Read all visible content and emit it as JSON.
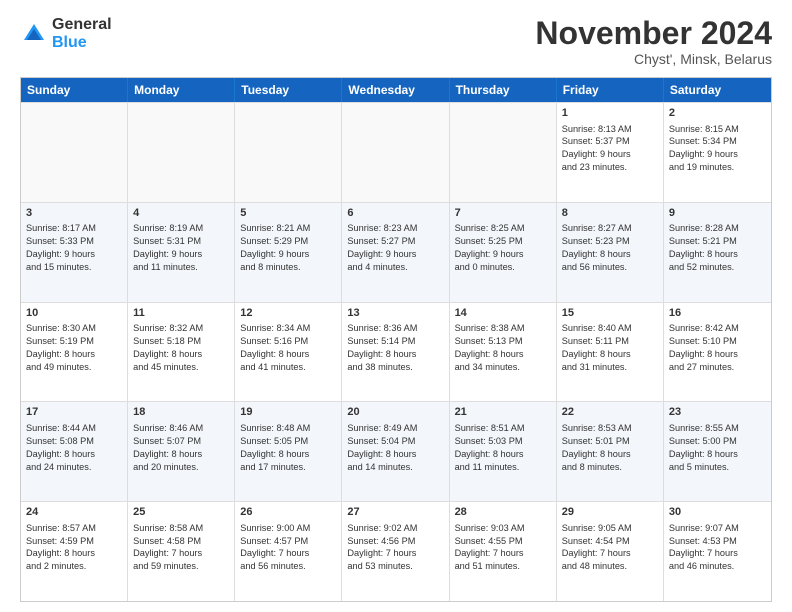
{
  "logo": {
    "general": "General",
    "blue": "Blue"
  },
  "title": "November 2024",
  "location": "Chyst', Minsk, Belarus",
  "headers": [
    "Sunday",
    "Monday",
    "Tuesday",
    "Wednesday",
    "Thursday",
    "Friday",
    "Saturday"
  ],
  "rows": [
    [
      {
        "day": "",
        "lines": [],
        "empty": true
      },
      {
        "day": "",
        "lines": [],
        "empty": true
      },
      {
        "day": "",
        "lines": [],
        "empty": true
      },
      {
        "day": "",
        "lines": [],
        "empty": true
      },
      {
        "day": "",
        "lines": [],
        "empty": true
      },
      {
        "day": "1",
        "lines": [
          "Sunrise: 8:13 AM",
          "Sunset: 5:37 PM",
          "Daylight: 9 hours",
          "and 23 minutes."
        ]
      },
      {
        "day": "2",
        "lines": [
          "Sunrise: 8:15 AM",
          "Sunset: 5:34 PM",
          "Daylight: 9 hours",
          "and 19 minutes."
        ]
      }
    ],
    [
      {
        "day": "3",
        "lines": [
          "Sunrise: 8:17 AM",
          "Sunset: 5:33 PM",
          "Daylight: 9 hours",
          "and 15 minutes."
        ]
      },
      {
        "day": "4",
        "lines": [
          "Sunrise: 8:19 AM",
          "Sunset: 5:31 PM",
          "Daylight: 9 hours",
          "and 11 minutes."
        ]
      },
      {
        "day": "5",
        "lines": [
          "Sunrise: 8:21 AM",
          "Sunset: 5:29 PM",
          "Daylight: 9 hours",
          "and 8 minutes."
        ]
      },
      {
        "day": "6",
        "lines": [
          "Sunrise: 8:23 AM",
          "Sunset: 5:27 PM",
          "Daylight: 9 hours",
          "and 4 minutes."
        ]
      },
      {
        "day": "7",
        "lines": [
          "Sunrise: 8:25 AM",
          "Sunset: 5:25 PM",
          "Daylight: 9 hours",
          "and 0 minutes."
        ]
      },
      {
        "day": "8",
        "lines": [
          "Sunrise: 8:27 AM",
          "Sunset: 5:23 PM",
          "Daylight: 8 hours",
          "and 56 minutes."
        ]
      },
      {
        "day": "9",
        "lines": [
          "Sunrise: 8:28 AM",
          "Sunset: 5:21 PM",
          "Daylight: 8 hours",
          "and 52 minutes."
        ]
      }
    ],
    [
      {
        "day": "10",
        "lines": [
          "Sunrise: 8:30 AM",
          "Sunset: 5:19 PM",
          "Daylight: 8 hours",
          "and 49 minutes."
        ]
      },
      {
        "day": "11",
        "lines": [
          "Sunrise: 8:32 AM",
          "Sunset: 5:18 PM",
          "Daylight: 8 hours",
          "and 45 minutes."
        ]
      },
      {
        "day": "12",
        "lines": [
          "Sunrise: 8:34 AM",
          "Sunset: 5:16 PM",
          "Daylight: 8 hours",
          "and 41 minutes."
        ]
      },
      {
        "day": "13",
        "lines": [
          "Sunrise: 8:36 AM",
          "Sunset: 5:14 PM",
          "Daylight: 8 hours",
          "and 38 minutes."
        ]
      },
      {
        "day": "14",
        "lines": [
          "Sunrise: 8:38 AM",
          "Sunset: 5:13 PM",
          "Daylight: 8 hours",
          "and 34 minutes."
        ]
      },
      {
        "day": "15",
        "lines": [
          "Sunrise: 8:40 AM",
          "Sunset: 5:11 PM",
          "Daylight: 8 hours",
          "and 31 minutes."
        ]
      },
      {
        "day": "16",
        "lines": [
          "Sunrise: 8:42 AM",
          "Sunset: 5:10 PM",
          "Daylight: 8 hours",
          "and 27 minutes."
        ]
      }
    ],
    [
      {
        "day": "17",
        "lines": [
          "Sunrise: 8:44 AM",
          "Sunset: 5:08 PM",
          "Daylight: 8 hours",
          "and 24 minutes."
        ]
      },
      {
        "day": "18",
        "lines": [
          "Sunrise: 8:46 AM",
          "Sunset: 5:07 PM",
          "Daylight: 8 hours",
          "and 20 minutes."
        ]
      },
      {
        "day": "19",
        "lines": [
          "Sunrise: 8:48 AM",
          "Sunset: 5:05 PM",
          "Daylight: 8 hours",
          "and 17 minutes."
        ]
      },
      {
        "day": "20",
        "lines": [
          "Sunrise: 8:49 AM",
          "Sunset: 5:04 PM",
          "Daylight: 8 hours",
          "and 14 minutes."
        ]
      },
      {
        "day": "21",
        "lines": [
          "Sunrise: 8:51 AM",
          "Sunset: 5:03 PM",
          "Daylight: 8 hours",
          "and 11 minutes."
        ]
      },
      {
        "day": "22",
        "lines": [
          "Sunrise: 8:53 AM",
          "Sunset: 5:01 PM",
          "Daylight: 8 hours",
          "and 8 minutes."
        ]
      },
      {
        "day": "23",
        "lines": [
          "Sunrise: 8:55 AM",
          "Sunset: 5:00 PM",
          "Daylight: 8 hours",
          "and 5 minutes."
        ]
      }
    ],
    [
      {
        "day": "24",
        "lines": [
          "Sunrise: 8:57 AM",
          "Sunset: 4:59 PM",
          "Daylight: 8 hours",
          "and 2 minutes."
        ]
      },
      {
        "day": "25",
        "lines": [
          "Sunrise: 8:58 AM",
          "Sunset: 4:58 PM",
          "Daylight: 7 hours",
          "and 59 minutes."
        ]
      },
      {
        "day": "26",
        "lines": [
          "Sunrise: 9:00 AM",
          "Sunset: 4:57 PM",
          "Daylight: 7 hours",
          "and 56 minutes."
        ]
      },
      {
        "day": "27",
        "lines": [
          "Sunrise: 9:02 AM",
          "Sunset: 4:56 PM",
          "Daylight: 7 hours",
          "and 53 minutes."
        ]
      },
      {
        "day": "28",
        "lines": [
          "Sunrise: 9:03 AM",
          "Sunset: 4:55 PM",
          "Daylight: 7 hours",
          "and 51 minutes."
        ]
      },
      {
        "day": "29",
        "lines": [
          "Sunrise: 9:05 AM",
          "Sunset: 4:54 PM",
          "Daylight: 7 hours",
          "and 48 minutes."
        ]
      },
      {
        "day": "30",
        "lines": [
          "Sunrise: 9:07 AM",
          "Sunset: 4:53 PM",
          "Daylight: 7 hours",
          "and 46 minutes."
        ]
      }
    ]
  ]
}
